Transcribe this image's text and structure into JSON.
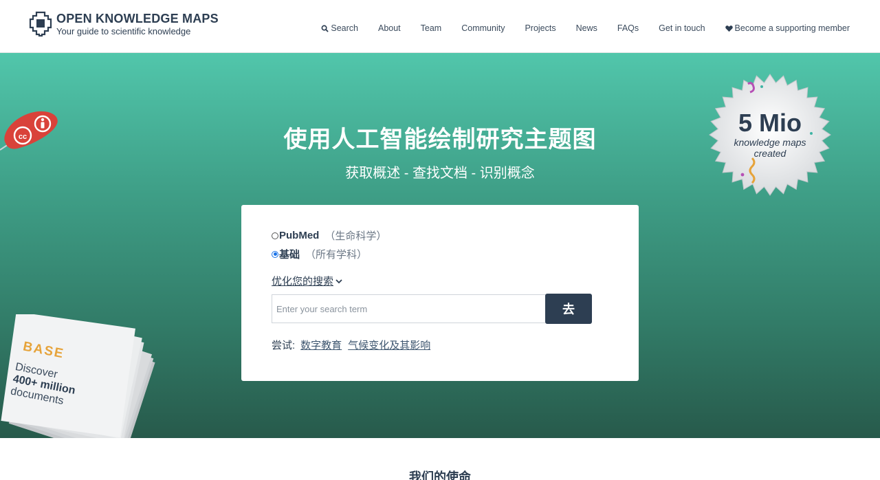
{
  "header": {
    "logo_title": "OPEN KNOWLEDGE MAPS",
    "logo_subtitle": "Your guide to scientific knowledge",
    "nav": [
      {
        "label": "Search",
        "icon": "search-icon"
      },
      {
        "label": "About"
      },
      {
        "label": "Team"
      },
      {
        "label": "Community"
      },
      {
        "label": "Projects"
      },
      {
        "label": "News"
      },
      {
        "label": "FAQs"
      },
      {
        "label": "Get in touch"
      },
      {
        "label": "Become a supporting member",
        "icon": "heart-icon"
      }
    ]
  },
  "hero": {
    "title": "使用人工智能绘制研究主题图",
    "subtitle": "获取概述 - 查找文档 - 识别概念"
  },
  "search": {
    "sources": [
      {
        "label": "PubMed",
        "hint": "（生命科学）",
        "checked": false
      },
      {
        "label": "基础",
        "hint": "（所有学科）",
        "checked": true
      }
    ],
    "refine_label": "优化您的搜索",
    "placeholder": "Enter your search term",
    "value": "",
    "go_label": "去",
    "try_label": "尝试:",
    "examples": [
      "数字教育",
      "气候变化及其影响"
    ]
  },
  "badge": {
    "big": "5 Mio",
    "line1": "knowledge maps",
    "line2": "created"
  },
  "base_promo": {
    "logo": "BASE",
    "line1": "Discover",
    "line2": "400+ million",
    "line3": "documents"
  },
  "mission": {
    "title": "我们的使命"
  },
  "colors": {
    "brand_dark": "#2d3e52",
    "hero_top": "#51c6ab",
    "hero_bottom": "#275a4b",
    "badge_accent": "#e6a33a"
  }
}
